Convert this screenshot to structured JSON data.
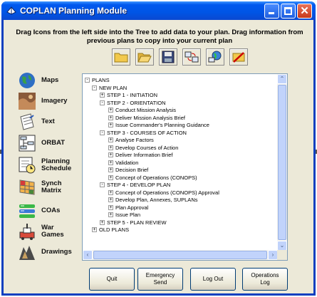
{
  "window": {
    "title": "COPLAN Planning Module",
    "controls": [
      "minimize-icon",
      "maximize-icon",
      "close-icon"
    ]
  },
  "instructions": {
    "line1": "Drag Icons from the left side into the Tree to add data to your plan.  Drag information from",
    "line2": "previous plans to copy into your current plan"
  },
  "toolbar": {
    "icons": [
      "new-folder-icon",
      "open-folder-icon",
      "save-disk-icon",
      "transfer-computers-icon",
      "network-globe-icon",
      "disconnect-icon"
    ]
  },
  "sidebar": {
    "items": [
      {
        "label": "Maps",
        "icon": "globe-icon"
      },
      {
        "label": "Imagery",
        "icon": "satellite-imagery-icon"
      },
      {
        "label": "Text",
        "icon": "document-icon"
      },
      {
        "label": "ORBAT",
        "icon": "org-chart-icon"
      },
      {
        "label": "Planning\nSchedule",
        "icon": "schedule-clock-icon"
      },
      {
        "label": "Synch\nMatrix",
        "icon": "matrix-grid-icon"
      },
      {
        "label": "COAs",
        "icon": "course-of-action-icon"
      },
      {
        "label": "War\nGames",
        "icon": "wargame-icon"
      },
      {
        "label": "Drawings",
        "icon": "drawing-icon"
      }
    ]
  },
  "tree": {
    "nodes": [
      {
        "label": "PLANS",
        "sign": "-"
      },
      {
        "label": "NEW PLAN",
        "sign": "-"
      },
      {
        "label": "STEP 1 - INITIATION",
        "sign": "+"
      },
      {
        "label": "STEP 2 - ORIENTATION",
        "sign": "-"
      },
      {
        "label": "Conduct Mission Analysis",
        "sign": "+"
      },
      {
        "label": "Deliver Mission Analysis Brief",
        "sign": "+"
      },
      {
        "label": "Issue Commander's Planning Guidance",
        "sign": "+"
      },
      {
        "label": "STEP 3 - COURSES OF ACTION",
        "sign": "-"
      },
      {
        "label": "Analyse Factors",
        "sign": "+"
      },
      {
        "label": "Develop Courses of Action",
        "sign": "+"
      },
      {
        "label": "Deliver Information Brief",
        "sign": "+"
      },
      {
        "label": "Validation",
        "sign": "+"
      },
      {
        "label": "Decision Brief",
        "sign": "+"
      },
      {
        "label": "Concept of Operations (CONOPS)",
        "sign": "+"
      },
      {
        "label": "STEP 4 - DEVELOP PLAN",
        "sign": "-"
      },
      {
        "label": "Concept of Operations (CONOPS) Approval",
        "sign": "+"
      },
      {
        "label": "Develop Plan, Annexes, SUPLANs",
        "sign": "+"
      },
      {
        "label": "Plan Approval",
        "sign": "+"
      },
      {
        "label": "Issue Plan",
        "sign": "+"
      },
      {
        "label": "STEP 5 - PLAN REVIEW",
        "sign": "+"
      },
      {
        "label": "OLD PLANS",
        "sign": "+"
      }
    ]
  },
  "buttons": {
    "quit": "Quit",
    "emergency_send": "Emergency\nSend",
    "log_out": "Log Out",
    "operations_log": "Operations\nLog"
  },
  "colors": {
    "titlebar": "#0055e5",
    "window_bg": "#ece9d8",
    "close_button": "#c8391a"
  }
}
